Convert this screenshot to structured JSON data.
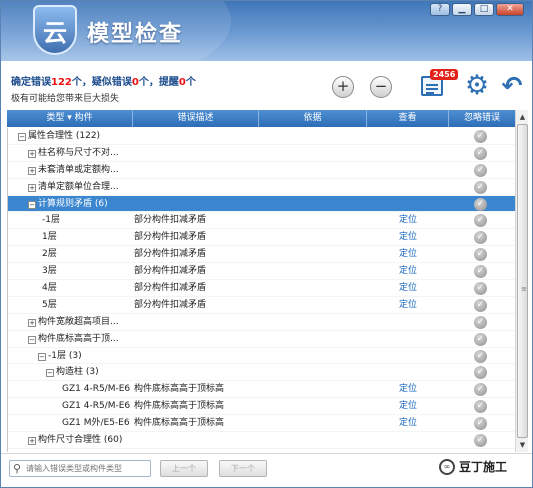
{
  "window": {
    "logo_char": "云",
    "title": "模型检查",
    "controls": {
      "help": "?",
      "minimize": "▁",
      "maximize": "□",
      "close": "✕"
    }
  },
  "summary": {
    "p1": "确定错误",
    "n1": "122",
    "p2": "个，疑似错误",
    "n2": "0",
    "p3": "个，提醒",
    "n3": "0",
    "p4": "个",
    "warning": "极有可能给您带来巨大损失"
  },
  "toolbar": {
    "expand_label": "+",
    "collapse_label": "−",
    "report_badge": "2456",
    "settings_icon": "gear-icon",
    "undo_icon": "undo-arrow-icon"
  },
  "columns": {
    "type": "类型 ▾ 构件",
    "desc": "错误描述",
    "basis": "依据",
    "view": "查看",
    "ignore": "忽略错误"
  },
  "rows": [
    {
      "label": "属性合理性 (122)",
      "toggle": "−",
      "desc": "",
      "view": "",
      "selected": false
    },
    {
      "label": "柱名称与尺寸不对...",
      "toggle": "+",
      "desc": "",
      "view": "",
      "selected": false
    },
    {
      "label": "未套清单或定额构...",
      "toggle": "+",
      "desc": "",
      "view": "",
      "selected": false
    },
    {
      "label": "清单定额单位合理...",
      "toggle": "+",
      "desc": "",
      "view": "",
      "selected": false
    },
    {
      "label": "计算规则矛盾 (6)",
      "toggle": "−",
      "desc": "",
      "view": "",
      "selected": true
    },
    {
      "label": "-1层",
      "toggle": "",
      "desc": "部分构件扣减矛盾",
      "view": "定位",
      "selected": false
    },
    {
      "label": "1层",
      "toggle": "",
      "desc": "部分构件扣减矛盾",
      "view": "定位",
      "selected": false
    },
    {
      "label": "2层",
      "toggle": "",
      "desc": "部分构件扣减矛盾",
      "view": "定位",
      "selected": false
    },
    {
      "label": "3层",
      "toggle": "",
      "desc": "部分构件扣减矛盾",
      "view": "定位",
      "selected": false
    },
    {
      "label": "4层",
      "toggle": "",
      "desc": "部分构件扣减矛盾",
      "view": "定位",
      "selected": false
    },
    {
      "label": "5层",
      "toggle": "",
      "desc": "部分构件扣减矛盾",
      "view": "定位",
      "selected": false
    },
    {
      "label": "构件宽敞超高项目...",
      "toggle": "+",
      "desc": "",
      "view": "",
      "selected": false
    },
    {
      "label": "构件底标高高于顶...",
      "toggle": "−",
      "desc": "",
      "view": "",
      "selected": false
    },
    {
      "label": "-1层 (3)",
      "toggle": "−",
      "desc": "",
      "view": "",
      "selected": false
    },
    {
      "label": "构造柱 (3)",
      "toggle": "−",
      "desc": "",
      "view": "",
      "selected": false
    },
    {
      "label": "GZ1 4-R5/M-E6",
      "toggle": "",
      "desc": "构件底标高高于顶标高",
      "view": "定位",
      "selected": false
    },
    {
      "label": "GZ1 4-R5/M-E6",
      "toggle": "",
      "desc": "构件底标高高于顶标高",
      "view": "定位",
      "selected": false
    },
    {
      "label": "GZ1 M外/E5-E6",
      "toggle": "",
      "desc": "构件底标高高于顶标高",
      "view": "定位",
      "selected": false
    },
    {
      "label": "构件尺寸合理性 (60)",
      "toggle": "+",
      "desc": "",
      "view": "",
      "selected": false
    }
  ],
  "bottom": {
    "search_placeholder": "请输入错误类型或构件类型",
    "prev": "上一个",
    "next": "下一个",
    "watermark": "豆丁施工"
  }
}
